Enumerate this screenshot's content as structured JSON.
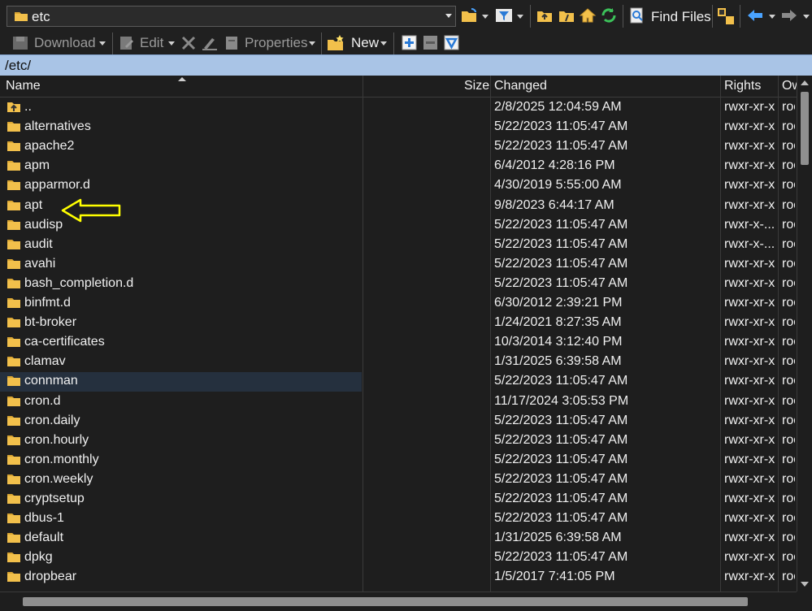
{
  "toolbar": {
    "path_value": "etc",
    "find_files_label": "Find Files",
    "icons": [
      "folder-icon",
      "open-folder-icon",
      "filter-icon",
      "parent-dir-icon",
      "root-dir-icon",
      "home-icon",
      "refresh-icon",
      "find-files-icon",
      "sync-browse-icon",
      "back-arrow-icon",
      "forward-arrow-icon"
    ]
  },
  "toolbar2": {
    "download_label": "Download",
    "edit_label": "Edit",
    "properties_label": "Properties",
    "new_label": "New"
  },
  "address": {
    "path": "/etc/"
  },
  "columns": {
    "name": "Name",
    "size": "Size",
    "changed": "Changed",
    "rights": "Rights",
    "owner": "Ow"
  },
  "colors": {
    "background": "#1e1e1e",
    "address_bar": "#a9c4e6",
    "folder": "#f2c04b",
    "selected_row": "#25303e",
    "annotation_arrow": "#ffff00"
  },
  "rows": [
    {
      "name": "..",
      "changed": "2/8/2025 12:04:59 AM",
      "rights": "rwxr-xr-x",
      "owner": "root",
      "parent": true
    },
    {
      "name": "alternatives",
      "changed": "5/22/2023 11:05:47 AM",
      "rights": "rwxr-xr-x",
      "owner": "root"
    },
    {
      "name": "apache2",
      "changed": "5/22/2023 11:05:47 AM",
      "rights": "rwxr-xr-x",
      "owner": "root"
    },
    {
      "name": "apm",
      "changed": "6/4/2012 4:28:16 PM",
      "rights": "rwxr-xr-x",
      "owner": "root"
    },
    {
      "name": "apparmor.d",
      "changed": "4/30/2019 5:55:00 AM",
      "rights": "rwxr-xr-x",
      "owner": "root"
    },
    {
      "name": "apt",
      "changed": "9/8/2023 6:44:17 AM",
      "rights": "rwxr-xr-x",
      "owner": "root"
    },
    {
      "name": "audisp",
      "changed": "5/22/2023 11:05:47 AM",
      "rights": "rwxr-x-...",
      "owner": "root"
    },
    {
      "name": "audit",
      "changed": "5/22/2023 11:05:47 AM",
      "rights": "rwxr-x-...",
      "owner": "root"
    },
    {
      "name": "avahi",
      "changed": "5/22/2023 11:05:47 AM",
      "rights": "rwxr-xr-x",
      "owner": "root"
    },
    {
      "name": "bash_completion.d",
      "changed": "5/22/2023 11:05:47 AM",
      "rights": "rwxr-xr-x",
      "owner": "root"
    },
    {
      "name": "binfmt.d",
      "changed": "6/30/2012 2:39:21 PM",
      "rights": "rwxr-xr-x",
      "owner": "root"
    },
    {
      "name": "bt-broker",
      "changed": "1/24/2021 8:27:35 AM",
      "rights": "rwxr-xr-x",
      "owner": "root"
    },
    {
      "name": "ca-certificates",
      "changed": "10/3/2014 3:12:40 PM",
      "rights": "rwxr-xr-x",
      "owner": "root"
    },
    {
      "name": "clamav",
      "changed": "1/31/2025 6:39:58 AM",
      "rights": "rwxr-xr-x",
      "owner": "root"
    },
    {
      "name": "connman",
      "changed": "5/22/2023 11:05:47 AM",
      "rights": "rwxr-xr-x",
      "owner": "root",
      "selected": true
    },
    {
      "name": "cron.d",
      "changed": "11/17/2024 3:05:53 PM",
      "rights": "rwxr-xr-x",
      "owner": "root"
    },
    {
      "name": "cron.daily",
      "changed": "5/22/2023 11:05:47 AM",
      "rights": "rwxr-xr-x",
      "owner": "root"
    },
    {
      "name": "cron.hourly",
      "changed": "5/22/2023 11:05:47 AM",
      "rights": "rwxr-xr-x",
      "owner": "root"
    },
    {
      "name": "cron.monthly",
      "changed": "5/22/2023 11:05:47 AM",
      "rights": "rwxr-xr-x",
      "owner": "root"
    },
    {
      "name": "cron.weekly",
      "changed": "5/22/2023 11:05:47 AM",
      "rights": "rwxr-xr-x",
      "owner": "root"
    },
    {
      "name": "cryptsetup",
      "changed": "5/22/2023 11:05:47 AM",
      "rights": "rwxr-xr-x",
      "owner": "root"
    },
    {
      "name": "dbus-1",
      "changed": "5/22/2023 11:05:47 AM",
      "rights": "rwxr-xr-x",
      "owner": "root"
    },
    {
      "name": "default",
      "changed": "1/31/2025 6:39:58 AM",
      "rights": "rwxr-xr-x",
      "owner": "root"
    },
    {
      "name": "dpkg",
      "changed": "5/22/2023 11:05:47 AM",
      "rights": "rwxr-xr-x",
      "owner": "root"
    },
    {
      "name": "dropbear",
      "changed": "1/5/2017 7:41:05 PM",
      "rights": "rwxr-xr-x",
      "owner": "root"
    }
  ]
}
